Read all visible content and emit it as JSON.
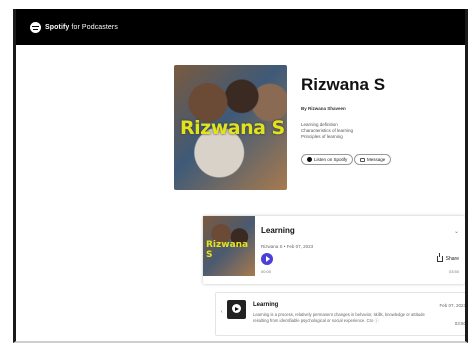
{
  "brand": {
    "name": "Spotify",
    "suffix": "for Podcasters"
  },
  "show": {
    "cover_text": "Rizwana S",
    "title": "Rizwana S",
    "author": "By Rizwana Shaveen",
    "description_lines": [
      "Learning definition",
      "Characteristics of learning",
      "Principles of learning"
    ],
    "listen_label": "Listen on Spotify",
    "message_label": "Message"
  },
  "episode": {
    "art_text": "Rizwana S",
    "title": "Learning",
    "meta": "Rizwana S • Feb 07, 2023",
    "time_elapsed": "00:00",
    "time_total": "03:50",
    "share_label": "Share",
    "chevron": "⌄"
  },
  "episode_list": [
    {
      "title": "Learning",
      "description": "Learning is a process, relatively permanent changes in behavior, skills, knowledge or attitude resulting from identifiable psychological or social experience. Cro ⓘ",
      "date": "Feb 07, 2023",
      "duration": "03:50",
      "arrow": "‹"
    }
  ],
  "colors": {
    "accent": "#4b3fd9",
    "topbar": "#000000",
    "cover_text": "#e3e31c"
  }
}
